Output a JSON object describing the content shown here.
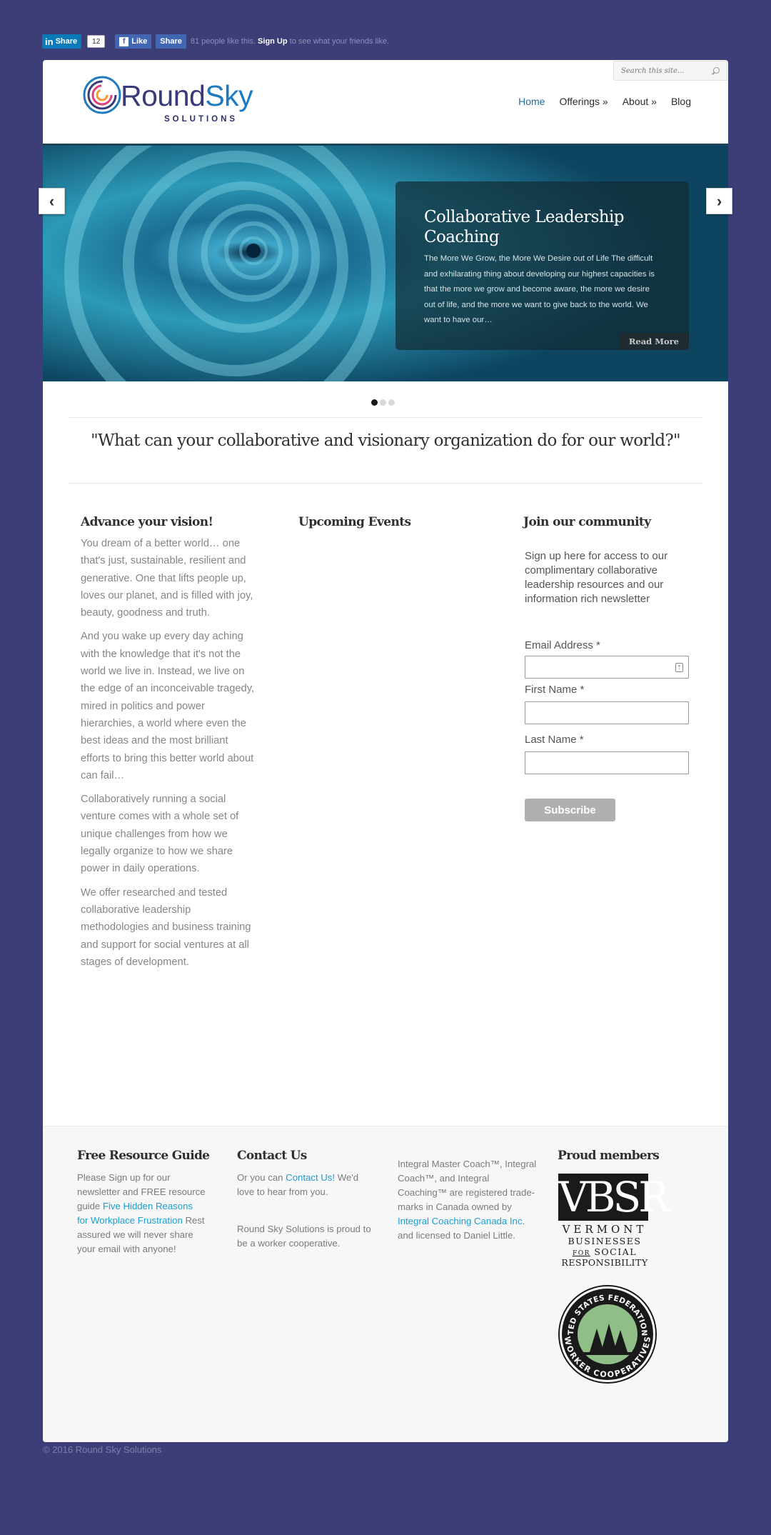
{
  "social": {
    "linkedin_label": "Share",
    "linkedin_logo": "in",
    "linkedin_count": "12",
    "fb_like_label": "Like",
    "fb_share_label": "Share",
    "fb_text_before": "81 people like this.",
    "fb_signup": "Sign Up",
    "fb_text_after": "to see what your friends like."
  },
  "search": {
    "placeholder": "Search this site..."
  },
  "logo": {
    "name_part1": "Round",
    "name_part2": "Sky",
    "subtitle": "SOLUTIONS"
  },
  "nav": [
    {
      "label": "Home"
    },
    {
      "label": "Offerings »"
    },
    {
      "label": "About »"
    },
    {
      "label": "Blog"
    }
  ],
  "slider": {
    "title": "Collaborative Leadership Coaching",
    "text": " The More We Grow, the More We Desire out of Life The difficult and exhilarating thing about developing our highest capacities is that the more we grow and become aware, the more we desire out of life, and the more we want to give back to the world. We want to have our…",
    "read_more": "Read More",
    "active_dot": 0,
    "dot_count": 3
  },
  "tagline": "\"What can your collaborative and visionary organization do for our world?\"",
  "advance": {
    "title": "Advance your vision!",
    "paragraphs": [
      "You dream of a better world… one that's just, sustainable, resilient and generative. One that lifts people up, loves our planet, and is filled with joy, beauty, goodness and truth.",
      "And you wake up every day aching with the knowledge that it's not the world we live in. Instead, we live on the edge of an inconceivable tragedy, mired in politics and power hierarchies, a world where even the best ideas and the most brilliant efforts to bring this better world about can fail…",
      "Collaboratively running a social venture comes with a whole set of unique challenges from how we legally organize to how we share power in daily operations.",
      "We offer researched and tested collaborative leadership methodologies and business training and support for social ventures at all stages of development."
    ]
  },
  "events": {
    "title": "Upcoming Events"
  },
  "community": {
    "title": "Join our community",
    "intro": "Sign up here for access to our complimentary collaborative leadership resources and our information rich newsletter",
    "email_label": "Email Address *",
    "first_label": "First Name *",
    "last_label": "Last Name *",
    "subscribe": "Subscribe"
  },
  "footer": {
    "guide_title": "Free Resource Guide",
    "guide_text_before": "Please Sign up for our newsletter and FREE resource guide ",
    "guide_link": "Five Hidden Reasons for Workplace Frustration",
    "guide_text_after": " Rest assured we will never share your email with anyone!",
    "contact_title": "Contact Us",
    "contact_before": "Or you can ",
    "contact_link": "Contact Us!",
    "contact_after": " We'd love to hear from you.",
    "coop_text": "Round Sky Solutions is proud to be a worker cooperative.",
    "tm_before": "Integral Master Coach™, Integral Coach™, and Integral Coaching™ are registered trade-marks in Canada owned by ",
    "tm_link": "Integral Coaching Canada Inc.",
    "tm_after": " and licensed to Daniel Little.",
    "members_title": "Proud members",
    "vbsr_logo": "VBSR",
    "vbsr_line1": "VERMONT",
    "vbsr_line2a": "BUSINESSES",
    "vbsr_line2b_for": "FOR",
    "vbsr_line2c": "SOCIAL",
    "vbsr_line3": "RESPONSIBILITY",
    "usfwc_top": "UNITED STATES FEDERATION OF",
    "usfwc_bottom": "WORKER COOPERATIVES"
  },
  "copyright": "© 2016 Round Sky Solutions",
  "colors": {
    "background": "#3d3e78",
    "link": "#1a9ed1",
    "nav_active": "#1d6f98",
    "slider_overlay": "#122c36"
  }
}
